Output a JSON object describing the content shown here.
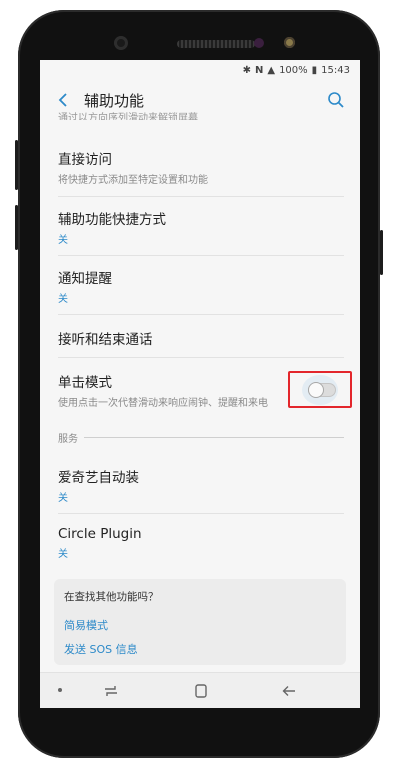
{
  "status_bar": {
    "battery": "100%",
    "time": "15:43"
  },
  "header": {
    "title": "辅助功能"
  },
  "cut_off_subtitle": "通过以方向序列滑动来解锁屏幕",
  "items": [
    {
      "title": "直接访问",
      "subtitle": "将快捷方式添加至特定设置和功能"
    },
    {
      "title": "辅助功能快捷方式",
      "subtitle": "关"
    },
    {
      "title": "通知提醒",
      "subtitle": "关"
    },
    {
      "title": "接听和结束通话"
    },
    {
      "title": "单击模式",
      "subtitle": "使用点击一次代替滑动来响应闹钟、提醒和来电"
    }
  ],
  "section_label": "服务",
  "services": [
    {
      "title": "爱奇艺自动装",
      "subtitle": "关"
    },
    {
      "title": "Circle Plugin",
      "subtitle": "关"
    }
  ],
  "card": {
    "question": "在查找其他功能吗？",
    "link1": "简易模式",
    "link2": "发送 SOS 信息"
  },
  "toggle": {
    "single_tap_mode_on": false
  },
  "colors": {
    "accent": "#2d8ac9",
    "highlight": "#e3262b"
  }
}
